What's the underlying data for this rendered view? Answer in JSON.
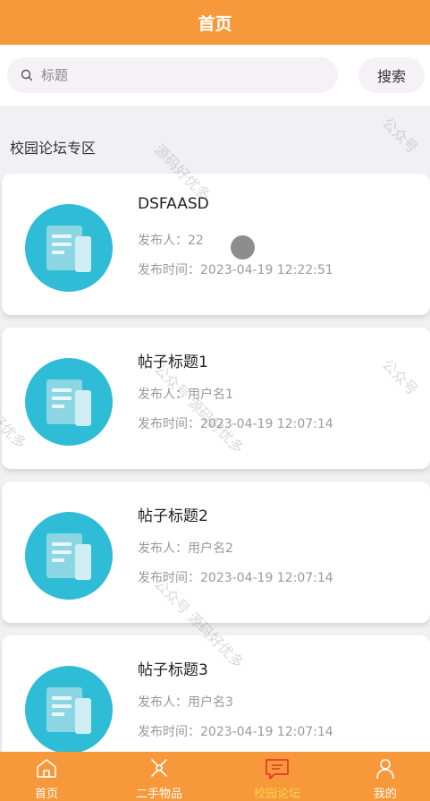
{
  "header": {
    "title": "首页"
  },
  "search": {
    "placeholder": "标题",
    "button_label": "搜索"
  },
  "section": {
    "title": "校园论坛专区"
  },
  "posts": [
    {
      "title": "DSFAASD",
      "author": "发布人：22",
      "time": "发布时间：2023-04-19 12:22:51"
    },
    {
      "title": "帖子标题1",
      "author": "发布人：用户名1",
      "time": "发布时间：2023-04-19 12:07:14"
    },
    {
      "title": "帖子标题2",
      "author": "发布人：用户名2",
      "time": "发布时间：2023-04-19 12:07:14"
    },
    {
      "title": "帖子标题3",
      "author": "发布人：用户名3",
      "time": "发布时间：2023-04-19 12:07:14"
    }
  ],
  "tabbar": {
    "items": [
      {
        "label": "首页",
        "icon": "home-icon",
        "active": false
      },
      {
        "label": "二手物品",
        "icon": "goods-icon",
        "active": false
      },
      {
        "label": "校园论坛",
        "icon": "forum-icon",
        "active": true
      },
      {
        "label": "我的",
        "icon": "person-icon",
        "active": false
      }
    ]
  },
  "watermarks": [
    "公众号",
    "源码好优多",
    "公众号",
    "好优多",
    "公众号 源码好优多",
    "公众号 源码好优多"
  ],
  "colors": {
    "primary": "#f7993b",
    "accent_active": "#f5d34b",
    "thumb": "#2fbcd6",
    "background": "#f1f1f3"
  }
}
